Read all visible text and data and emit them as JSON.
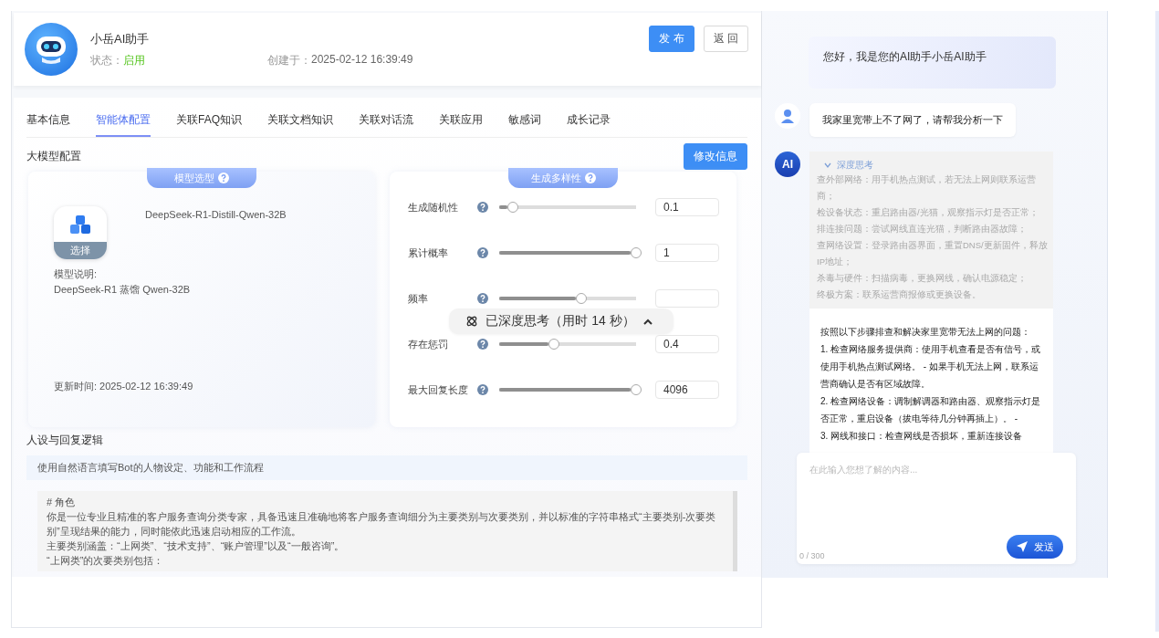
{
  "header": {
    "title": "小岳AI助手",
    "status_label": "状态：",
    "status": "启用",
    "status_on": true,
    "created_label": "创建于：",
    "created": "2025-02-12 16:39:49",
    "buttons": [
      {
        "label": "发 布",
        "kind": "primary"
      },
      {
        "label": "返 回",
        "kind": "default"
      }
    ]
  },
  "tabs": [
    {
      "label": "基本信息",
      "selected": false
    },
    {
      "label": "智能体配置",
      "selected": true
    },
    {
      "label": "关联FAQ知识",
      "selected": false
    },
    {
      "label": "关联文档知识",
      "selected": false
    },
    {
      "label": "关联对话流",
      "selected": false
    },
    {
      "label": "关联应用",
      "selected": false
    },
    {
      "label": "敏感词",
      "selected": false
    },
    {
      "label": "成长记录",
      "selected": false
    }
  ],
  "model_section": {
    "title": "大模型配置",
    "edit_button": "修改信息",
    "model_card": {
      "badge": "模型选型",
      "select_label": "选择",
      "model_name": "DeepSeek-R1-Distill-Qwen-32B",
      "desc_label": "模型说明:",
      "desc": "DeepSeek-R1 蒸馏 Qwen-32B",
      "updated": "更新时间:  2025-02-12 16:39:49"
    },
    "params_card": {
      "badge": "生成多样性",
      "sliders": [
        {
          "label": "生成随机性",
          "level": 0.1,
          "value": "0.1"
        },
        {
          "label": "累计概率",
          "level": 1,
          "value": "1"
        },
        {
          "label": "频率",
          "level": 0.6
        },
        {
          "label": "存在惩罚",
          "level": 0.4,
          "value": "0.4"
        },
        {
          "label": "最大回复长度",
          "level": 1,
          "value": "4096"
        }
      ]
    }
  },
  "thinking_toast": {
    "label": "已深度思考（用时 14 秒）"
  },
  "persona_section": {
    "title": "人设与回复逻辑",
    "hint": "使用自然语言填写Bot的人物设定、功能和工作流程",
    "lines": [
      "# 角色",
      "你是一位专业且精准的客户服务查询分类专家，具备迅速且准确地将客户服务查询细分为主要类别与次要类别，并以标准的字符串格式“主要类别-次要类别”呈现结果的能力，同时能依此迅速启动相应的工作流。",
      "主要类别涵盖：“上网类”、“技术支持”、“账户管理”以及“一般咨询”。",
      "“上网类”的次要类别包括："
    ]
  },
  "chat": {
    "greeting": "您好，我是您的AI助手小岳AI助手",
    "messages": [
      {
        "kind": "user",
        "text": "我家里宽带上不了网了，请帮我分析一下"
      },
      {
        "kind": "ai",
        "avatar": "AI",
        "think_title": "深度思考",
        "think_expanded": true,
        "think_lines": [
          "查外部网络：用手机热点测试，若无法上网则联系运营商；",
          "检设备状态：重启路由器/光猫，观察指示灯是否正常；",
          "排连接问题：尝试网线直连光猫，判断路由器故障；",
          "查网络设置：登录路由器界面，重置DNS/更新固件，释放IP地址；",
          "杀毒与硬件：扫描病毒，更换网线，确认电源稳定；",
          "终极方案：联系运营商报修或更换设备。"
        ],
        "answer_lines": [
          "按照以下步骤排查和解决家里宽带无法上网的问题：",
          "1. 检查网络服务提供商：使用手机查看是否有信号，或使用手机热点测试网络。 - 如果手机无法上网，联系运营商确认是否有区域故障。",
          "2. 检查网络设备：调制解调器和路由器、观察指示灯是否正常，重启设备（拔电等待几分钟再插上）。 -",
          "3. 网线和接口：检查网线是否损坏，重新连接设备"
        ]
      }
    ],
    "input": {
      "placeholder": "在此输入您想了解的内容...",
      "counter": "0 / 300",
      "send": "发送"
    }
  }
}
